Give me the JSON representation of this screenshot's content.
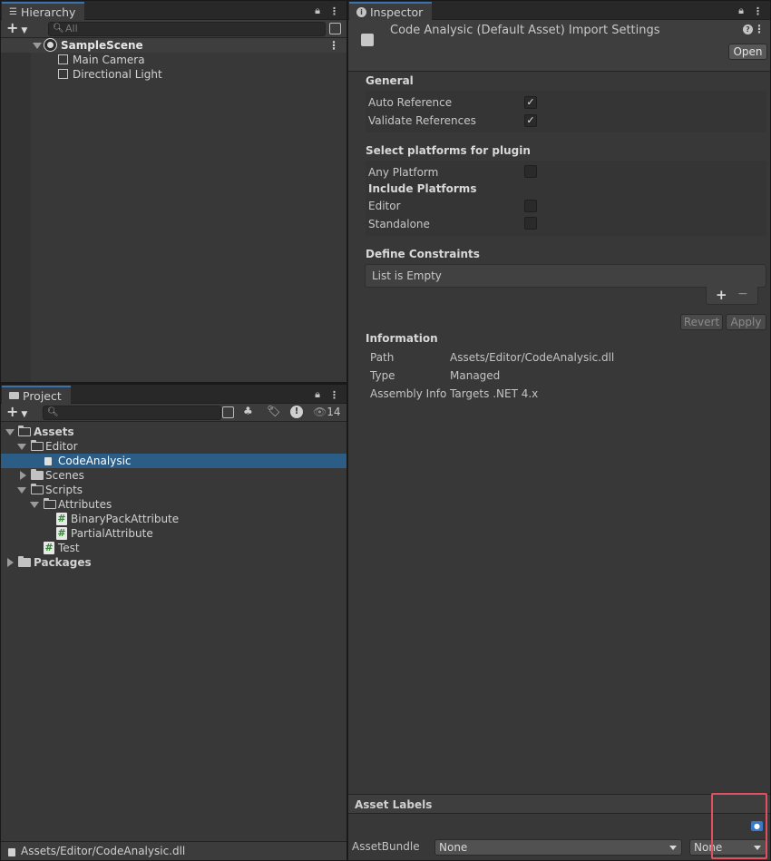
{
  "hierarchy": {
    "tab_label": "Hierarchy",
    "search_placeholder": "All",
    "scene_name": "SampleScene",
    "objects": [
      "Main Camera",
      "Directional Light"
    ]
  },
  "project": {
    "tab_label": "Project",
    "hidden_count": "14",
    "tree": {
      "assets": "Assets",
      "editor": "Editor",
      "code_analysic": "CodeAnalysic",
      "scenes": "Scenes",
      "scripts": "Scripts",
      "attributes": "Attributes",
      "binary_pack": "BinaryPackAttribute",
      "partial": "PartialAttribute",
      "test": "Test",
      "packages": "Packages"
    },
    "status_path": "Assets/Editor/CodeAnalysic.dll"
  },
  "inspector": {
    "tab_label": "Inspector",
    "title": "Code Analysic (Default Asset) Import Settings",
    "open_label": "Open",
    "general": {
      "title": "General",
      "auto_reference": "Auto Reference",
      "validate_references": "Validate References"
    },
    "platforms": {
      "title": "Select platforms for plugin",
      "any_platform": "Any Platform",
      "include_platforms": "Include Platforms",
      "editor": "Editor",
      "standalone": "Standalone"
    },
    "constraints": {
      "title": "Define Constraints",
      "empty": "List is Empty"
    },
    "revert_label": "Revert",
    "apply_label": "Apply",
    "information": {
      "title": "Information",
      "path_label": "Path",
      "path_value": "Assets/Editor/CodeAnalysic.dll",
      "type_label": "Type",
      "type_value": "Managed",
      "assembly_label": "Assembly Info",
      "assembly_value": "Targets .NET 4.x"
    },
    "asset_labels_title": "Asset Labels",
    "asset_bundle_label": "AssetBundle",
    "bundle_value": "None",
    "variant_value": "None"
  },
  "colors": {
    "selection": "#2c5d87",
    "tab_accent": "#3a72b0",
    "highlight_box": "#e0505f"
  }
}
